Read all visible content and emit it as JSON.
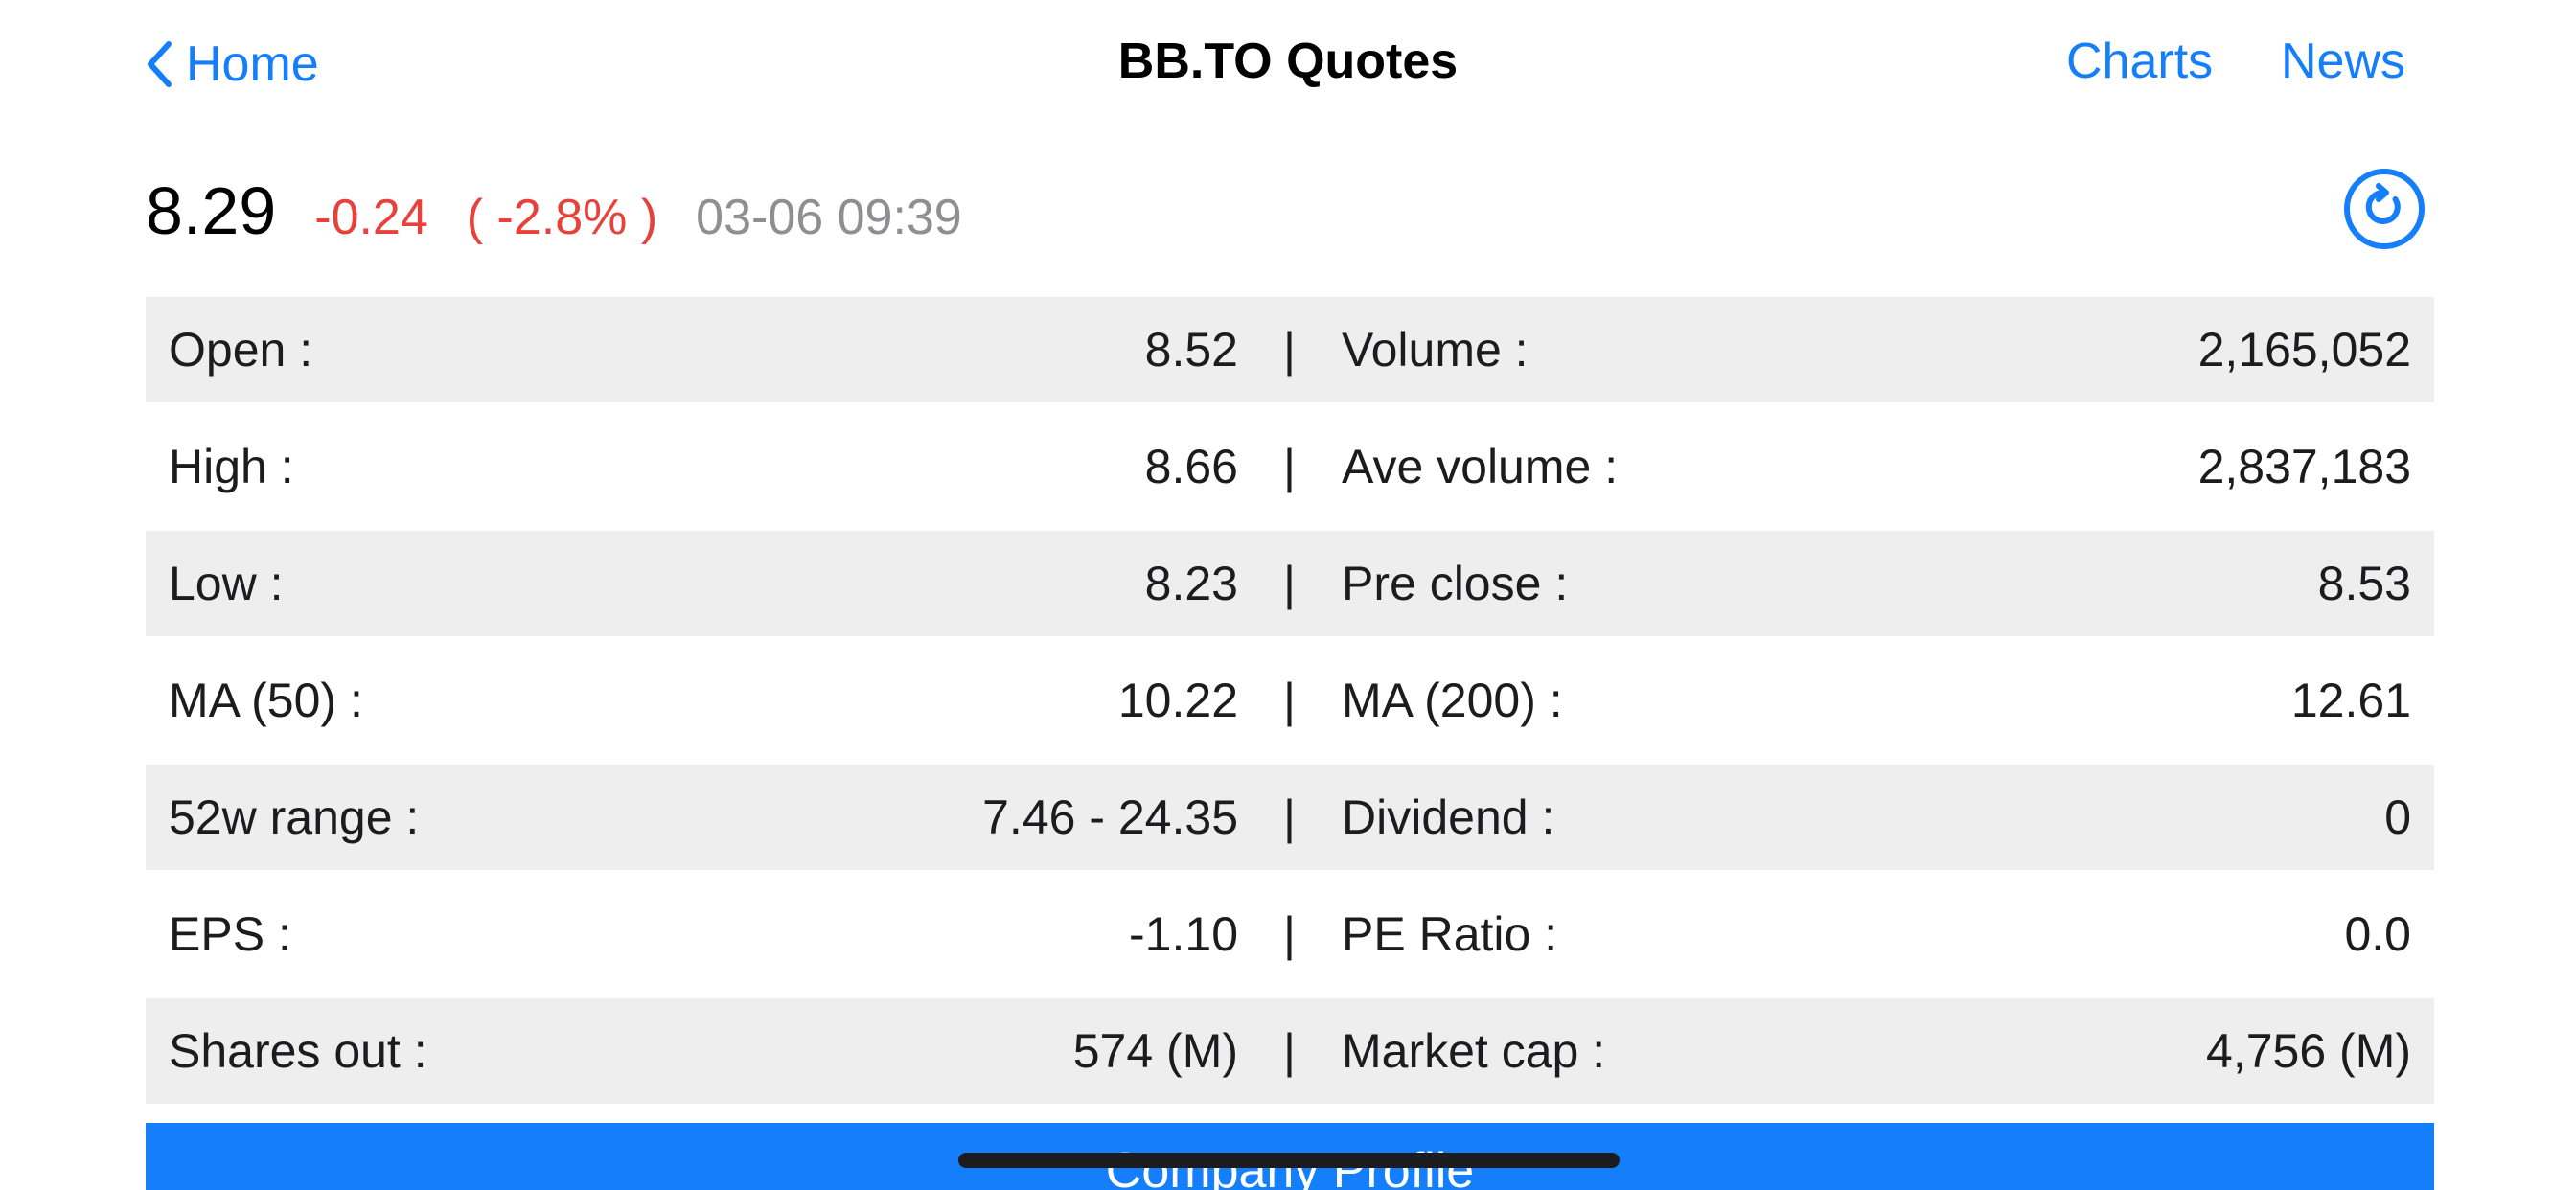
{
  "nav": {
    "back_label": "Home",
    "title": "BB.TO Quotes",
    "links": {
      "charts": "Charts",
      "news": "News"
    }
  },
  "quote": {
    "price": "8.29",
    "change": "-0.24",
    "change_pct": "( -2.8% )",
    "timestamp": "03-06 09:39"
  },
  "stats": [
    {
      "left_label": "Open :",
      "left_value": "8.52",
      "right_label": "Volume :",
      "right_value": "2,165,052"
    },
    {
      "left_label": "High :",
      "left_value": "8.66",
      "right_label": "Ave volume :",
      "right_value": "2,837,183"
    },
    {
      "left_label": "Low :",
      "left_value": "8.23",
      "right_label": "Pre close :",
      "right_value": "8.53"
    },
    {
      "left_label": "MA (50) :",
      "left_value": "10.22",
      "right_label": "MA (200) :",
      "right_value": "12.61"
    },
    {
      "left_label": "52w range :",
      "left_value": "7.46 - 24.35",
      "right_label": "Dividend :",
      "right_value": "0"
    },
    {
      "left_label": "EPS :",
      "left_value": "-1.10",
      "right_label": "PE Ratio :",
      "right_value": "0.0"
    },
    {
      "left_label": "Shares out :",
      "left_value": "574 (M)",
      "right_label": "Market cap :",
      "right_value": "4,756 (M)"
    }
  ],
  "separator": "|",
  "profile_button": "Company Profile",
  "colors": {
    "accent": "#157EFB",
    "negative": "#E8413B",
    "muted": "#8E8E93",
    "row_shade": "#EEEEEE"
  },
  "icons": {
    "back": "chevron-left-icon",
    "refresh": "refresh-icon"
  }
}
